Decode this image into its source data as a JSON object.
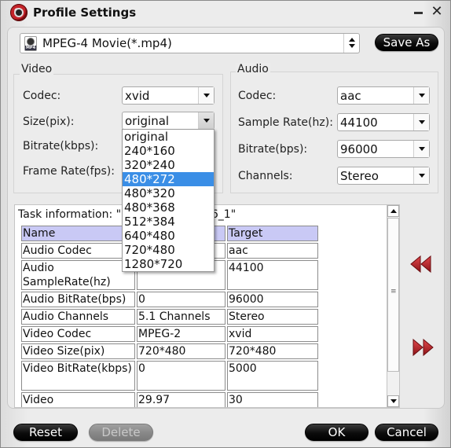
{
  "window": {
    "title": "Profile Settings",
    "minimize_icon": "minimize-icon",
    "close_icon": "close-icon",
    "close_glyph": "✕"
  },
  "format": {
    "icon": "mp4-file-icon",
    "icon_badge": "MP4",
    "selected": "MPEG-4 Movie(*.mp4)",
    "save_as_label": "Save As"
  },
  "video": {
    "group_title": "Video",
    "codec_label": "Codec:",
    "codec_value": "xvid",
    "size_label": "Size(pix):",
    "size_value": "original",
    "bitrate_label": "Bitrate(kbps):",
    "framerate_label": "Frame Rate(fps):",
    "size_options": [
      "original",
      "240*160",
      "320*240",
      "480*272",
      "480*320",
      "480*368",
      "512*384",
      "640*480",
      "720*480",
      "1280*720"
    ],
    "size_highlighted": "480*272"
  },
  "audio": {
    "group_title": "Audio",
    "codec_label": "Codec:",
    "codec_value": "aac",
    "samplerate_label": "Sample Rate(hz):",
    "samplerate_value": "44100",
    "bitrate_label": "Bitrate(bps):",
    "bitrate_value": "96000",
    "channels_label": "Channels:",
    "channels_value": "Stereo"
  },
  "task": {
    "info_text": "Task information: \"ROBINSONS_US 6_1\"",
    "columns": [
      "Name",
      "",
      "Target"
    ],
    "rows": [
      [
        "Audio Codec",
        "",
        "aac"
      ],
      [
        "Audio SampleRate(hz)",
        "",
        "44100"
      ],
      [
        "Audio BitRate(bps)",
        "0",
        "96000"
      ],
      [
        "Audio Channels",
        "5.1 Channels",
        "Stereo"
      ],
      [
        "Video Codec",
        "MPEG-2",
        "xvid"
      ],
      [
        "Video Size(pix)",
        "720*480",
        "720*480"
      ],
      [
        "Video BitRate(kbps)",
        "0",
        "5000"
      ],
      [
        "Video FrameRate(fps)",
        "29.97",
        "30"
      ]
    ]
  },
  "nav": {
    "prev_icon": "rewind-icon",
    "next_icon": "fast-forward-icon",
    "accent_color": "#c0282d"
  },
  "buttons": {
    "reset": "Reset",
    "delete": "Delete",
    "ok": "OK",
    "cancel": "Cancel"
  }
}
